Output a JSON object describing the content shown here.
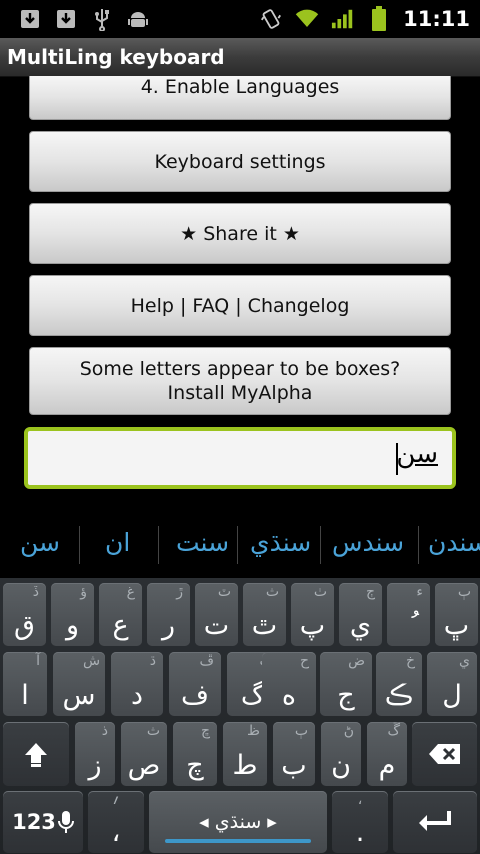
{
  "status": {
    "time": "11:11",
    "left_icons": [
      "download-icon",
      "download-icon",
      "usb-icon",
      "android-debug-icon"
    ],
    "right_icons": [
      "vibrate-icon",
      "wifi-icon",
      "signal-icon",
      "battery-icon"
    ],
    "accent": "#9bc31e"
  },
  "app": {
    "title": "MultiLing keyboard"
  },
  "buttons": {
    "enable_languages": "4. Enable Languages",
    "keyboard_settings": "Keyboard settings",
    "share": "★ Share it ★",
    "help": "Help | FAQ | Changelog",
    "boxes_line1": "Some letters appear to be boxes?",
    "boxes_line2": "Install MyAlpha"
  },
  "input": {
    "value": "سن"
  },
  "suggestions": [
    "سن",
    "ان",
    "سنت",
    "سنڌي",
    "سندس",
    "سندن"
  ],
  "keyboard": {
    "row1": [
      {
        "main": "ق",
        "hint": "ڏ"
      },
      {
        "main": "و",
        "hint": "ؤ"
      },
      {
        "main": "ع",
        "hint": "غ"
      },
      {
        "main": "ر",
        "hint": "ڙ"
      },
      {
        "main": "ت",
        "hint": "ٽ"
      },
      {
        "main": "ٿ",
        "hint": "ث"
      },
      {
        "main": "پ",
        "hint": "ٺ"
      },
      {
        "main": "ي",
        "hint": "ڄ"
      },
      {
        "main": "ُ",
        "hint": "ء"
      },
      {
        "main": "ڀ",
        "hint": "ٻ"
      }
    ],
    "row2": [
      {
        "main": "ا",
        "hint": "آ"
      },
      {
        "main": "س",
        "hint": "ش"
      },
      {
        "main": "د",
        "hint": "ڌ"
      },
      {
        "main": "ف",
        "hint": "ڦ"
      },
      {
        "main": "گ",
        "hint": "ڳ"
      },
      {
        "main": "ه",
        "hint": "ح"
      },
      {
        "main": "ج",
        "hint": "ض"
      },
      {
        "main": "ڪ",
        "hint": "خ"
      },
      {
        "main": "ل",
        "hint": "ي"
      }
    ],
    "row3": [
      {
        "main": "ز",
        "hint": "ذ"
      },
      {
        "main": "ص",
        "hint": "ث"
      },
      {
        "main": "چ",
        "hint": "ڇ"
      },
      {
        "main": "ط",
        "hint": "ظ"
      },
      {
        "main": "ب",
        "hint": "ٻ"
      },
      {
        "main": "ن",
        "hint": "ڻ"
      },
      {
        "main": "م",
        "hint": "ڱ"
      }
    ],
    "mode_label": "123",
    "comma_key": "،",
    "comma_hint": "؍",
    "space_label": "◂ سنڌي ▸",
    "period_key": ".",
    "period_hint": "،"
  }
}
